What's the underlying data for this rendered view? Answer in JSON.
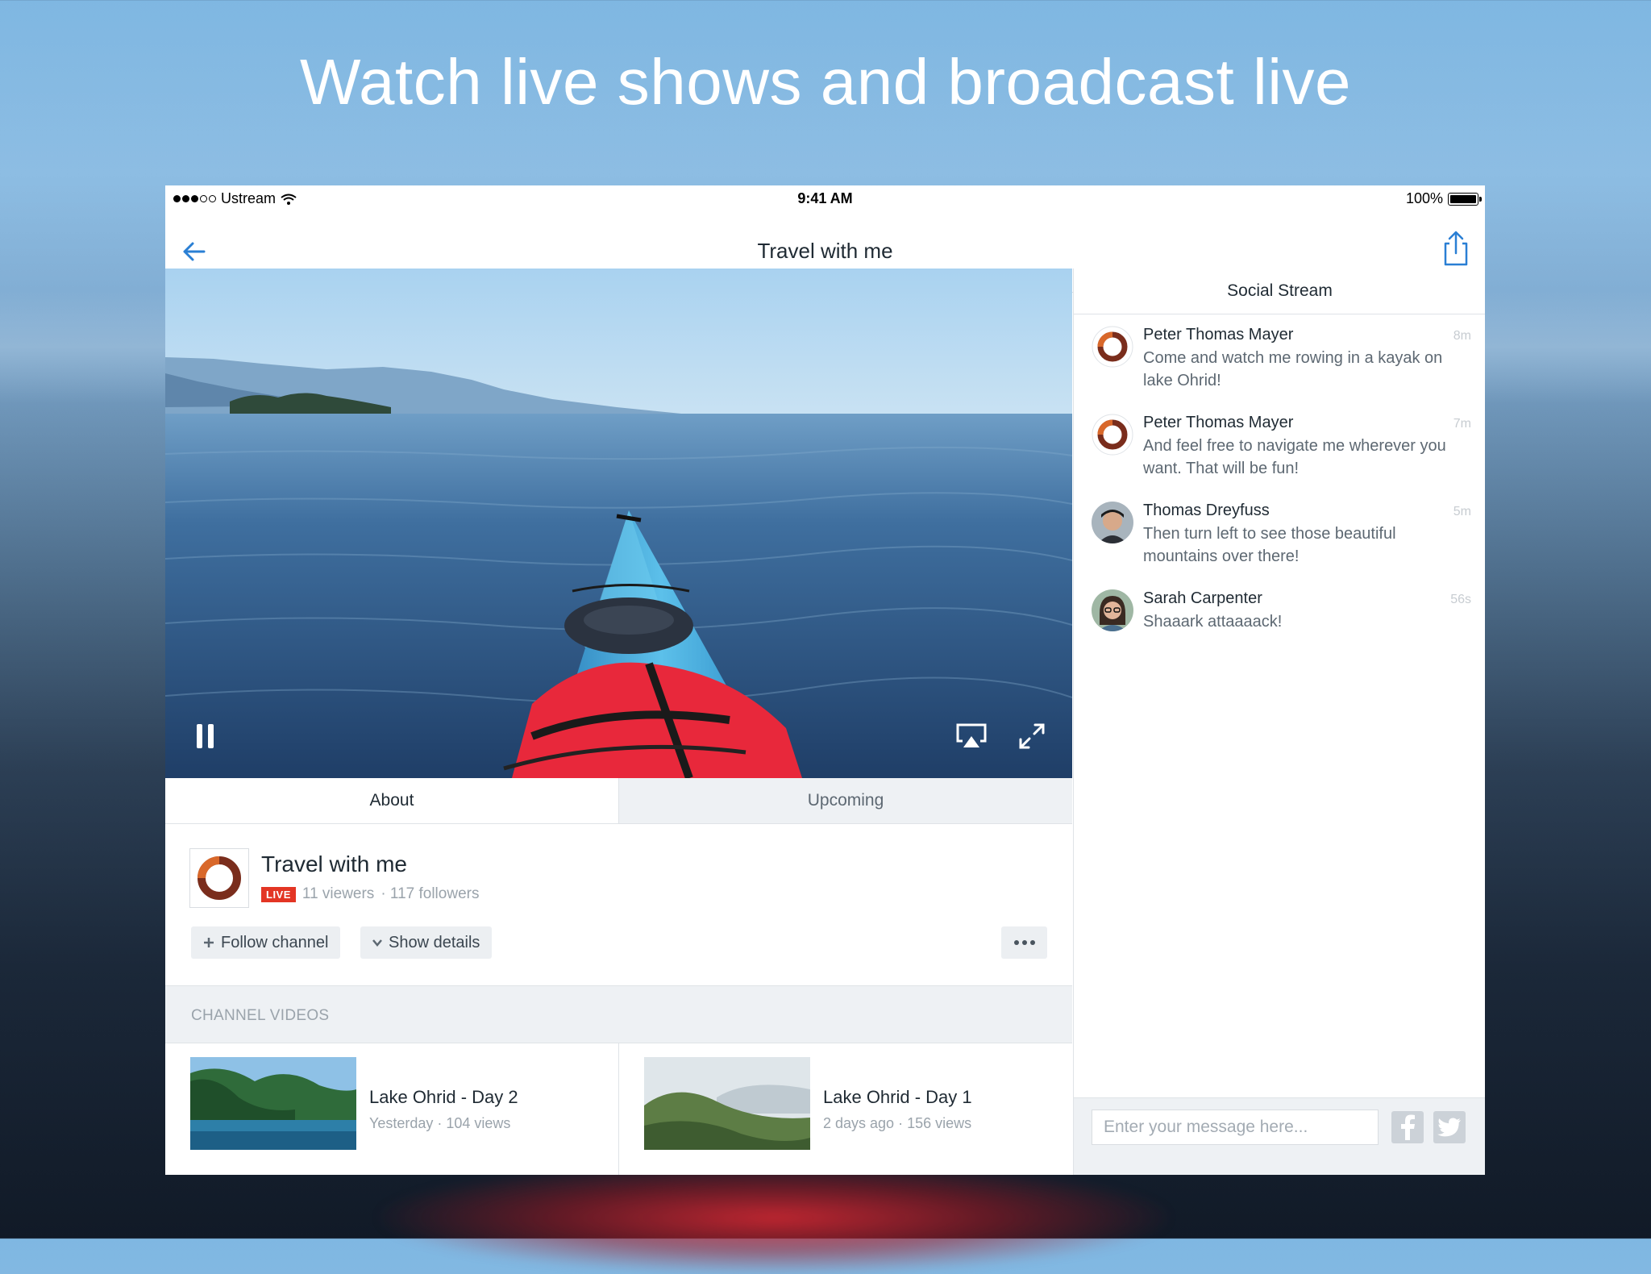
{
  "headline": "Watch live shows and broadcast live",
  "status_bar": {
    "carrier": "Ustream",
    "time": "9:41 AM",
    "battery": "100%"
  },
  "nav": {
    "title": "Travel with me",
    "back_icon": "back-arrow-icon",
    "share_icon": "share-icon"
  },
  "player": {
    "pause_icon": "pause-icon",
    "airplay_icon": "airplay-icon",
    "fullscreen_icon": "fullscreen-icon"
  },
  "tabs": [
    {
      "label": "About",
      "active": true
    },
    {
      "label": "Upcoming",
      "active": false
    }
  ],
  "channel": {
    "title": "Travel with me",
    "live_badge": "LIVE",
    "viewers": "11 viewers",
    "followers": "· 117 followers",
    "follow_label": "Follow channel",
    "details_label": "Show details"
  },
  "channel_videos": {
    "header": "CHANNEL VIDEOS",
    "items": [
      {
        "title": "Lake Ohrid - Day 2",
        "meta": "Yesterday · 104 views"
      },
      {
        "title": "Lake Ohrid - Day 1",
        "meta": "2 days ago · 156 views"
      }
    ]
  },
  "social_stream": {
    "header": "Social Stream",
    "messages": [
      {
        "name": "Peter Thomas Mayer",
        "time": "8m",
        "text": "Come and watch me rowing in a kayak on lake Ohrid!"
      },
      {
        "name": "Peter Thomas Mayer",
        "time": "7m",
        "text": "And feel free to navigate me wherever you want. That will be fun!"
      },
      {
        "name": "Thomas Dreyfuss",
        "time": "5m",
        "text": "Then turn left to see those beautiful mountains over there!"
      },
      {
        "name": "Sarah Carpenter",
        "time": "56s",
        "text": "Shaaark attaaaack!"
      }
    ],
    "input_placeholder": "Enter your message here..."
  },
  "colors": {
    "accent": "#2a7fd4",
    "live": "#e33524",
    "text_primary": "#1f2a33",
    "text_secondary": "#9aa3ab"
  }
}
